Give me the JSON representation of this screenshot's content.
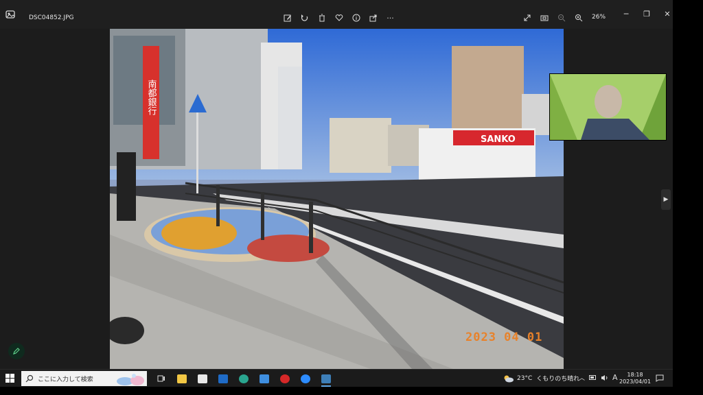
{
  "titlebar": {
    "file_name": "DSC04852.JPG",
    "zoom": "26%",
    "toolbar_icons": [
      "edit-image-icon",
      "rotate-icon",
      "delete-icon",
      "favorite-icon",
      "info-icon",
      "share-icon",
      "more-icon"
    ],
    "right_icons": [
      "fullscreen-icon",
      "slideshow-icon",
      "zoom-out-icon",
      "zoom-in-icon"
    ]
  },
  "photo": {
    "date_stamp": "2023 04 01",
    "signs": {
      "bank_vertical": "南都銀行",
      "store_sign": "SANKO"
    }
  },
  "taskbar": {
    "search_placeholder": "ここに入力して検索",
    "weather_temp": "23°C",
    "weather_text": "くもりのち晴れ",
    "ime": "A",
    "time": "18:18",
    "date": "2023/04/01"
  },
  "colors": {
    "accent": "#60a9e8",
    "date_stamp": "#e8822a",
    "sky": "#3f78d6",
    "store_red": "#d7272e"
  }
}
